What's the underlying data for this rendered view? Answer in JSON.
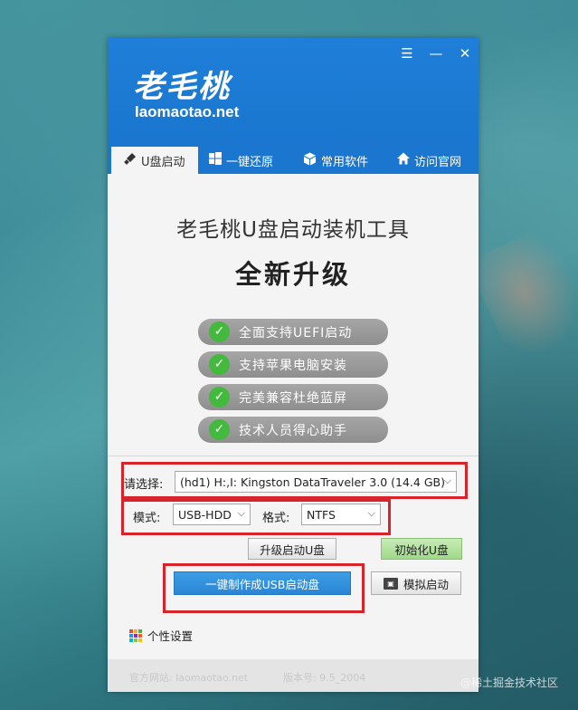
{
  "app": {
    "logo_cn": "老毛桃",
    "logo_en": "laomaotao.net",
    "window_buttons": {
      "menu": "☰",
      "minimize": "—",
      "close": "✕"
    }
  },
  "tabs": [
    {
      "label": "U盘启动",
      "icon": "usb-icon",
      "active": true
    },
    {
      "label": "一键还原",
      "icon": "windows-icon",
      "active": false
    },
    {
      "label": "常用软件",
      "icon": "box-icon",
      "active": false
    },
    {
      "label": "访问官网",
      "icon": "home-icon",
      "active": false
    }
  ],
  "main": {
    "title": "老毛桃U盘启动装机工具",
    "subtitle": "全新升级",
    "features": [
      "全面支持UEFI启动",
      "支持苹果电脑安装",
      "完美兼容杜绝蓝屏",
      "技术人员得心助手"
    ]
  },
  "form": {
    "select_label": "请选择:",
    "device_value": "(hd1) H:,I: Kingston DataTraveler 3.0 (14.4 GB)",
    "mode_label": "模式:",
    "mode_value": "USB-HDD",
    "format_label": "格式:",
    "format_value": "NTFS",
    "upgrade_button": "升级启动U盘",
    "init_button": "初始化U盘",
    "make_button": "一键制作成USB启动盘",
    "simulate_button": "模拟启动"
  },
  "bottom": {
    "personal_settings": "个性设置",
    "footer_left": "官方网站: laomaotao.net",
    "footer_right": "版本号: 9.5_2004",
    "watermark": "@稀土掘金技术社区"
  },
  "colors": {
    "header_blue": "#1f7fd8",
    "check_green": "#43b93e",
    "highlight_red": "#d9232b",
    "primary_button": "#2a86d4"
  }
}
